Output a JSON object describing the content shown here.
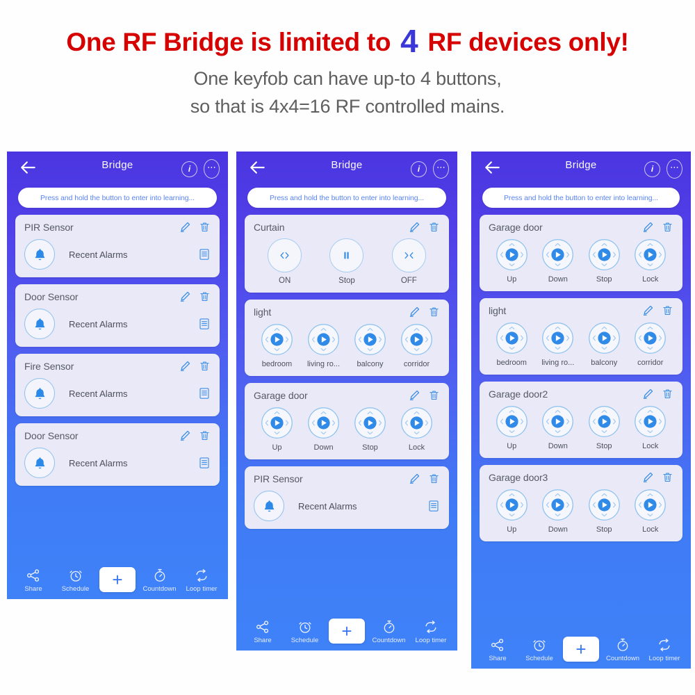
{
  "headline": {
    "part1": "One RF Bridge is limited to",
    "highlight": "4",
    "part2": "RF devices only!",
    "color": "#d60000",
    "highlight_color": "#3a36d8"
  },
  "subtitle": {
    "line1": "One keyfob can have up-to 4 buttons,",
    "line2": "so that is 4x4=16 RF controlled mains."
  },
  "phones": [
    {
      "header": {
        "title": "Bridge",
        "back_icon": "back-arrow-icon",
        "info_icon": "info-icon",
        "more_icon": "more-options-icon"
      },
      "learning_bar": "Press and hold the button to enter into learning...",
      "cards": [
        {
          "type": "sensor",
          "title": "PIR Sensor",
          "icon": "bell-icon",
          "label": "Recent Alarms",
          "list_icon": "list-icon"
        },
        {
          "type": "sensor",
          "title": "Door Sensor",
          "icon": "bell-icon",
          "label": "Recent Alarms",
          "list_icon": "list-icon"
        },
        {
          "type": "sensor",
          "title": "Fire Sensor",
          "icon": "bell-icon",
          "label": "Recent Alarms",
          "list_icon": "list-icon"
        },
        {
          "type": "sensor",
          "title": "Door Sensor",
          "icon": "bell-icon",
          "label": "Recent Alarms",
          "list_icon": "list-icon"
        }
      ],
      "toolbar": {
        "share": "Share",
        "schedule": "Schedule",
        "add": "+",
        "countdown": "Countdown",
        "loop": "Loop timer"
      }
    },
    {
      "header": {
        "title": "Bridge",
        "back_icon": "back-arrow-icon",
        "info_icon": "info-icon",
        "more_icon": "more-options-icon"
      },
      "learning_bar": "Press and hold the button to enter into learning...",
      "cards": [
        {
          "type": "curtain",
          "title": "Curtain",
          "buttons": [
            {
              "label": "ON",
              "icon": "open-arrows-icon"
            },
            {
              "label": "Stop",
              "icon": "pause-icon"
            },
            {
              "label": "OFF",
              "icon": "close-arrows-icon"
            }
          ]
        },
        {
          "type": "dpad4",
          "title": "light",
          "buttons": [
            {
              "label": "bedroom"
            },
            {
              "label": "living ro..."
            },
            {
              "label": "balcony"
            },
            {
              "label": "corridor"
            }
          ]
        },
        {
          "type": "dpad4",
          "title": "Garage door",
          "buttons": [
            {
              "label": "Up"
            },
            {
              "label": "Down"
            },
            {
              "label": "Stop"
            },
            {
              "label": "Lock"
            }
          ]
        },
        {
          "type": "sensor",
          "title": "PIR Sensor",
          "icon": "bell-icon",
          "label": "Recent Alarms",
          "list_icon": "list-icon"
        }
      ],
      "toolbar": {
        "share": "Share",
        "schedule": "Schedule",
        "add": "+",
        "countdown": "Countdown",
        "loop": "Loop timer"
      }
    },
    {
      "header": {
        "title": "Bridge",
        "back_icon": "back-arrow-icon",
        "info_icon": "info-icon",
        "more_icon": "more-options-icon"
      },
      "learning_bar": "Press and hold the button to enter into learning...",
      "cards": [
        {
          "type": "dpad4",
          "title": "Garage door",
          "buttons": [
            {
              "label": "Up"
            },
            {
              "label": "Down"
            },
            {
              "label": "Stop"
            },
            {
              "label": "Lock"
            }
          ]
        },
        {
          "type": "dpad4",
          "title": "light",
          "buttons": [
            {
              "label": "bedroom"
            },
            {
              "label": "living ro..."
            },
            {
              "label": "balcony"
            },
            {
              "label": "corridor"
            }
          ]
        },
        {
          "type": "dpad4",
          "title": "Garage door2",
          "buttons": [
            {
              "label": "Up"
            },
            {
              "label": "Down"
            },
            {
              "label": "Stop"
            },
            {
              "label": "Lock"
            }
          ]
        },
        {
          "type": "dpad4",
          "title": "Garage door3",
          "buttons": [
            {
              "label": "Up"
            },
            {
              "label": "Down"
            },
            {
              "label": "Stop"
            },
            {
              "label": "Lock"
            }
          ]
        }
      ],
      "toolbar": {
        "share": "Share",
        "schedule": "Schedule",
        "add": "+",
        "countdown": "Countdown",
        "loop": "Loop timer"
      }
    }
  ],
  "icons": {
    "edit": "edit-pencil-icon",
    "trash": "trash-icon"
  }
}
